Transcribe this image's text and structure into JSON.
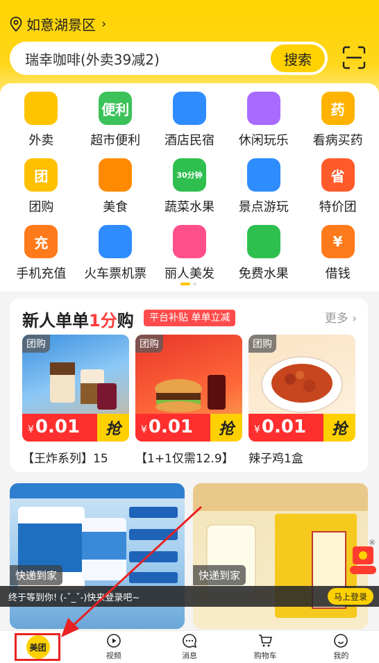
{
  "location": {
    "label": "如意湖景区"
  },
  "search": {
    "query": "瑞幸咖啡(外卖39减2)",
    "button": "搜索"
  },
  "categories": [
    {
      "label": "外卖",
      "icon": "takeout-icon",
      "color": "#ffc400"
    },
    {
      "label": "超市便利",
      "icon": "supermarket-icon",
      "color": "#3cc25a",
      "badge": "便利"
    },
    {
      "label": "酒店民宿",
      "icon": "hotel-icon",
      "color": "#2f8cff"
    },
    {
      "label": "休闲玩乐",
      "icon": "leisure-icon",
      "color": "#a86bff"
    },
    {
      "label": "看病买药",
      "icon": "medicine-icon",
      "color": "#ffb300",
      "badge": "药"
    },
    {
      "label": "团购",
      "icon": "groupbuy-icon",
      "color": "#ffc000",
      "badge": "团"
    },
    {
      "label": "美食",
      "icon": "food-icon",
      "color": "#ff8a00"
    },
    {
      "label": "蔬菜水果",
      "icon": "vegetable-icon",
      "color": "#2fbf4f",
      "badge": "30分钟"
    },
    {
      "label": "景点游玩",
      "icon": "scenic-icon",
      "color": "#2f8cff"
    },
    {
      "label": "特价团",
      "icon": "special-deal-icon",
      "color": "#ff5a2a",
      "badge": "省"
    },
    {
      "label": "手机充值",
      "icon": "recharge-icon",
      "color": "#ff7a1a",
      "badge": "充"
    },
    {
      "label": "火车票机票",
      "icon": "train-plane-icon",
      "color": "#2f8cff"
    },
    {
      "label": "丽人美发",
      "icon": "beauty-icon",
      "color": "#ff4f8a"
    },
    {
      "label": "免费水果",
      "icon": "free-fruit-icon",
      "color": "#2fbf4f"
    },
    {
      "label": "借钱",
      "icon": "loan-icon",
      "color": "#ff7a1a",
      "badge": "¥"
    }
  ],
  "promo": {
    "title_a": "新人单单",
    "title_hl": "1分",
    "title_b": "购",
    "tag": "平台补贴 单单立减",
    "more": "更多",
    "deals": [
      {
        "badge": "团购",
        "price_symbol": "¥",
        "price": "0.01",
        "grab": "抢",
        "name": "【王炸系列】15"
      },
      {
        "badge": "团购",
        "price_symbol": "¥",
        "price": "0.01",
        "grab": "抢",
        "name": "【1+1仅需12.9】"
      },
      {
        "badge": "团购",
        "price_symbol": "¥",
        "price": "0.01",
        "grab": "抢",
        "name": "辣子鸡1盒"
      }
    ]
  },
  "feed": [
    {
      "tag": "快递到家"
    },
    {
      "tag": "快递到家"
    }
  ],
  "login_bar": {
    "text": "终于等到你! (-ˇ_ˇ-)快来登录吧~",
    "button": "马上登录"
  },
  "tabs": [
    {
      "label": "美团",
      "icon": "meituan-logo"
    },
    {
      "label": "视频",
      "icon": "video-icon"
    },
    {
      "label": "消息",
      "icon": "message-icon"
    },
    {
      "label": "购物车",
      "icon": "cart-icon"
    },
    {
      "label": "我的",
      "icon": "profile-icon"
    }
  ],
  "colors": {
    "brand": "#ffd100",
    "accent_red": "#ff2f2f",
    "annotation_red": "#e82222"
  }
}
